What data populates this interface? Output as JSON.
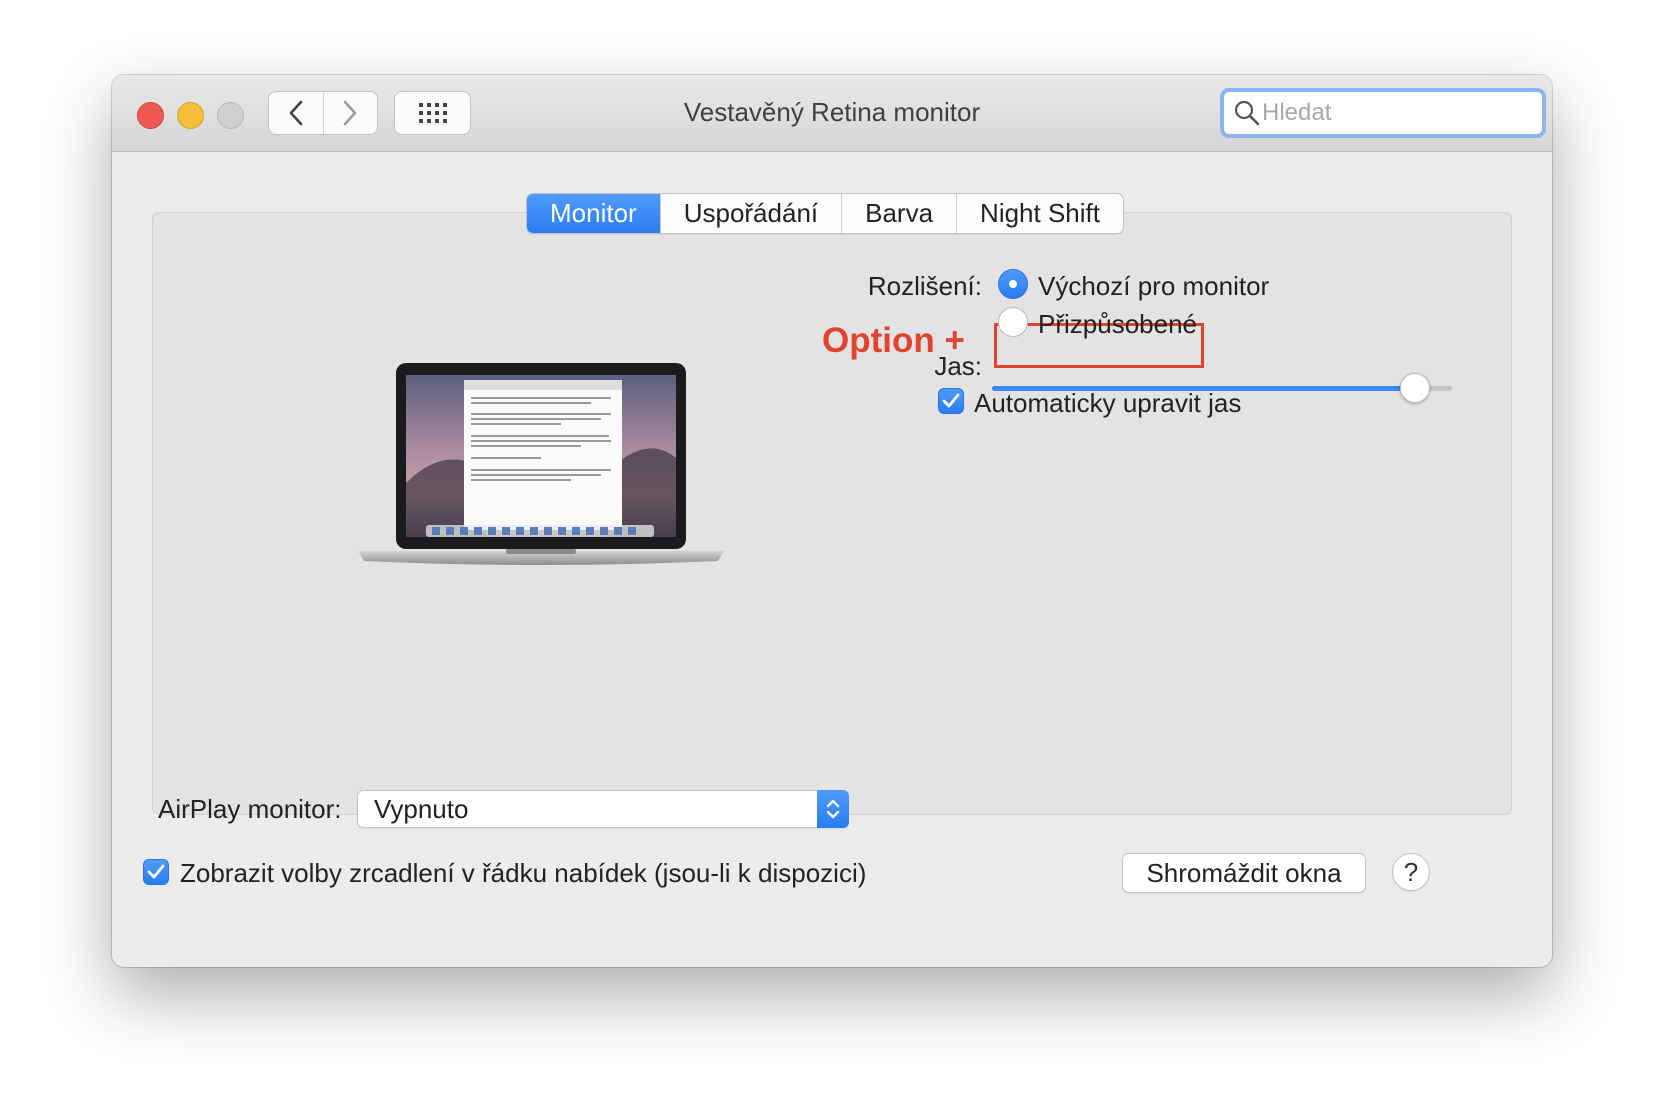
{
  "window": {
    "title": "Vestavěný Retina monitor",
    "search_placeholder": "Hledat"
  },
  "tabs": [
    {
      "label": "Monitor",
      "active": true
    },
    {
      "label": "Uspořádání",
      "active": false
    },
    {
      "label": "Barva",
      "active": false
    },
    {
      "label": "Night Shift",
      "active": false
    }
  ],
  "display": {
    "resolution_label": "Rozlišení:",
    "option_default": "Výchozí pro monitor",
    "option_scaled": "Přizpůsobené",
    "selected_option": "default",
    "annotation": "Option +",
    "brightness_label": "Jas:",
    "brightness_level": 0.92,
    "auto_brightness_label": "Automaticky upravit jas",
    "auto_brightness_checked": true
  },
  "airplay": {
    "label": "AirPlay monitor:",
    "value": "Vypnuto"
  },
  "mirroring": {
    "label": "Zobrazit volby zrcadlení v řádku nabídek (jsou-li k dispozici)",
    "checked": true
  },
  "buttons": {
    "gather": "Shromáždit okna",
    "help": "?"
  },
  "colors": {
    "accent": "#2f80f1",
    "annotation": "#e0432e",
    "close": "#ee5a52",
    "minimize": "#f4bd3a",
    "zoom": "#cfcfcf"
  }
}
